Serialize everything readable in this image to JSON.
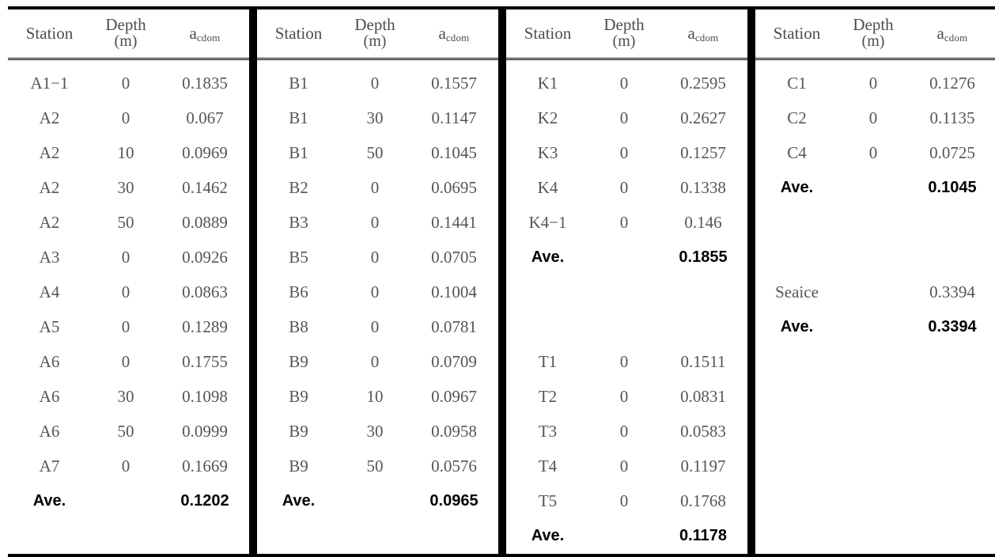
{
  "document": {
    "type": "data-table",
    "description": "CDOM absorption coefficient measurements by station and depth"
  },
  "header": {
    "station": "Station",
    "depth": "Depth",
    "depth_unit": "(m)",
    "a_symbol": "a",
    "a_subscript": "cdom"
  },
  "colors": {
    "rule": "#000000",
    "body_text": "#555555",
    "header_text": "#4d4d4d",
    "emphasis_text": "#000000"
  },
  "groups": [
    {
      "name": "group-a",
      "rows": [
        {
          "station": "A1−1",
          "depth": "0",
          "a": "0.1835",
          "emphasis": false
        },
        {
          "station": "A2",
          "depth": "0",
          "a": "0.067",
          "emphasis": false
        },
        {
          "station": "A2",
          "depth": "10",
          "a": "0.0969",
          "emphasis": false
        },
        {
          "station": "A2",
          "depth": "30",
          "a": "0.1462",
          "emphasis": false
        },
        {
          "station": "A2",
          "depth": "50",
          "a": "0.0889",
          "emphasis": false
        },
        {
          "station": "A3",
          "depth": "0",
          "a": "0.0926",
          "emphasis": false
        },
        {
          "station": "A4",
          "depth": "0",
          "a": "0.0863",
          "emphasis": false
        },
        {
          "station": "A5",
          "depth": "0",
          "a": "0.1289",
          "emphasis": false
        },
        {
          "station": "A6",
          "depth": "0",
          "a": "0.1755",
          "emphasis": false
        },
        {
          "station": "A6",
          "depth": "30",
          "a": "0.1098",
          "emphasis": false
        },
        {
          "station": "A6",
          "depth": "50",
          "a": "0.0999",
          "emphasis": false
        },
        {
          "station": "A7",
          "depth": "0",
          "a": "0.1669",
          "emphasis": false
        },
        {
          "station": "Ave.",
          "depth": "",
          "a": "0.1202",
          "emphasis": true
        }
      ]
    },
    {
      "name": "group-b",
      "rows": [
        {
          "station": "B1",
          "depth": "0",
          "a": "0.1557",
          "emphasis": false
        },
        {
          "station": "B1",
          "depth": "30",
          "a": "0.1147",
          "emphasis": false
        },
        {
          "station": "B1",
          "depth": "50",
          "a": "0.1045",
          "emphasis": false
        },
        {
          "station": "B2",
          "depth": "0",
          "a": "0.0695",
          "emphasis": false
        },
        {
          "station": "B3",
          "depth": "0",
          "a": "0.1441",
          "emphasis": false
        },
        {
          "station": "B5",
          "depth": "0",
          "a": "0.0705",
          "emphasis": false
        },
        {
          "station": "B6",
          "depth": "0",
          "a": "0.1004",
          "emphasis": false
        },
        {
          "station": "B8",
          "depth": "0",
          "a": "0.0781",
          "emphasis": false
        },
        {
          "station": "B9",
          "depth": "0",
          "a": "0.0709",
          "emphasis": false
        },
        {
          "station": "B9",
          "depth": "10",
          "a": "0.0967",
          "emphasis": false
        },
        {
          "station": "B9",
          "depth": "30",
          "a": "0.0958",
          "emphasis": false
        },
        {
          "station": "B9",
          "depth": "50",
          "a": "0.0576",
          "emphasis": false
        },
        {
          "station": "Ave.",
          "depth": "",
          "a": "0.0965",
          "emphasis": true
        }
      ]
    },
    {
      "name": "group-kt",
      "rows": [
        {
          "station": "K1",
          "depth": "0",
          "a": "0.2595",
          "emphasis": false
        },
        {
          "station": "K2",
          "depth": "0",
          "a": "0.2627",
          "emphasis": false
        },
        {
          "station": "K3",
          "depth": "0",
          "a": "0.1257",
          "emphasis": false
        },
        {
          "station": "K4",
          "depth": "0",
          "a": "0.1338",
          "emphasis": false
        },
        {
          "station": "K4−1",
          "depth": "0",
          "a": "0.146",
          "emphasis": false
        },
        {
          "station": "Ave.",
          "depth": "",
          "a": "0.1855",
          "emphasis": true
        },
        {
          "station": "",
          "depth": "",
          "a": "",
          "emphasis": false,
          "blank": true
        },
        {
          "station": "",
          "depth": "",
          "a": "",
          "emphasis": false,
          "blank": true
        },
        {
          "station": "T1",
          "depth": "0",
          "a": "0.1511",
          "emphasis": false
        },
        {
          "station": "T2",
          "depth": "0",
          "a": "0.0831",
          "emphasis": false
        },
        {
          "station": "T3",
          "depth": "0",
          "a": "0.0583",
          "emphasis": false
        },
        {
          "station": "T4",
          "depth": "0",
          "a": "0.1197",
          "emphasis": false
        },
        {
          "station": "T5",
          "depth": "0",
          "a": "0.1768",
          "emphasis": false
        },
        {
          "station": "Ave.",
          "depth": "",
          "a": "0.1178",
          "emphasis": true
        }
      ]
    },
    {
      "name": "group-c",
      "rows": [
        {
          "station": "C1",
          "depth": "0",
          "a": "0.1276",
          "emphasis": false
        },
        {
          "station": "C2",
          "depth": "0",
          "a": "0.1135",
          "emphasis": false
        },
        {
          "station": "C4",
          "depth": "0",
          "a": "0.0725",
          "emphasis": false
        },
        {
          "station": "Ave.",
          "depth": "",
          "a": "0.1045",
          "emphasis": true
        },
        {
          "station": "",
          "depth": "",
          "a": "",
          "emphasis": false,
          "blank": true
        },
        {
          "station": "",
          "depth": "",
          "a": "",
          "emphasis": false,
          "blank": true
        },
        {
          "station": "Seaice",
          "depth": "",
          "a": "0.3394",
          "emphasis": false
        },
        {
          "station": "Ave.",
          "depth": "",
          "a": "0.3394",
          "emphasis": true
        }
      ]
    }
  ]
}
